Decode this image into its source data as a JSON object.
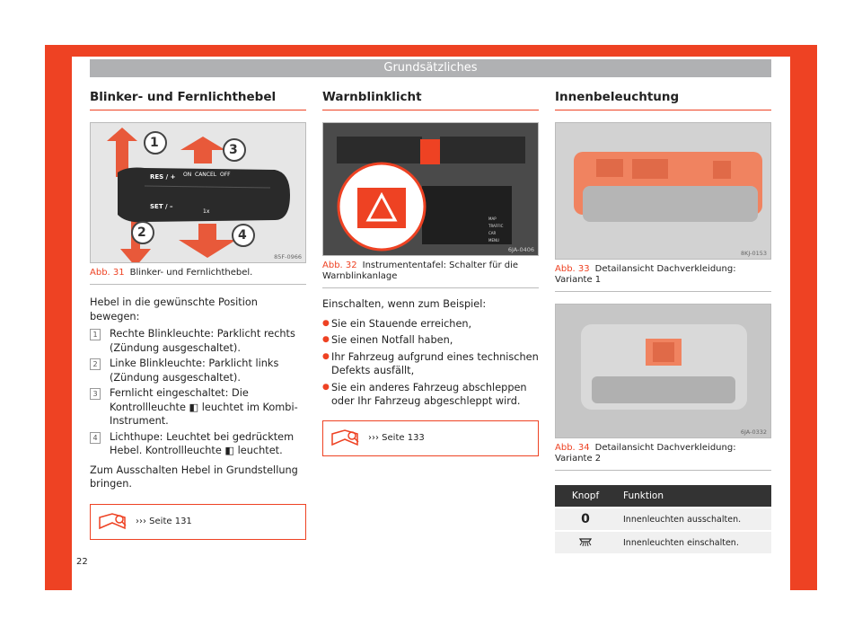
{
  "header": {
    "title": "Grundsätzliches"
  },
  "page_number": "22",
  "col1": {
    "heading": "Blinker- und Fernlichthebel",
    "figure": {
      "code": "85F-0966",
      "label": "Abb. 31",
      "caption": "Blinker- und Fernlichthebel.",
      "callouts": [
        "1",
        "2",
        "3",
        "4"
      ],
      "lever_labels": {
        "res": "RES / +",
        "set": "SET / –",
        "on": "ON",
        "cancel": "CANCEL",
        "off": "OFF",
        "one_x": "1x"
      }
    },
    "intro": "Hebel in die gewünschte Position bewegen:",
    "items": [
      {
        "n": "1",
        "text": "Rechte Blinkleuchte: Parklicht rechts (Zündung ausgeschaltet)."
      },
      {
        "n": "2",
        "text": "Linke Blinkleuchte: Parklicht links (Zündung ausgeschaltet)."
      },
      {
        "n": "3",
        "text": "Fernlicht eingeschaltet: Die Kontrollleuchte ◧ leuchtet im Kombi-Instrument."
      },
      {
        "n": "4",
        "text": "Lichthupe: Leuchtet bei gedrücktem Hebel. Kontrollleuchte ◧ leuchtet."
      }
    ],
    "outro": "Zum Ausschalten Hebel in Grundstellung bringen.",
    "ref": "››› Seite 131"
  },
  "col2": {
    "heading": "Warnblinklicht",
    "figure": {
      "code": "6JA-0406",
      "label": "Abb. 32",
      "caption": "Instrumententafel: Schalter für die Warnblinkanlage",
      "buttons": [
        "MAP",
        "TRAFFIC",
        "CAR",
        "MENU"
      ]
    },
    "intro": "Einschalten, wenn zum Beispiel:",
    "bullets": [
      "Sie ein Stauende erreichen,",
      "Sie einen Notfall haben,",
      "Ihr Fahrzeug aufgrund eines technischen Defekts ausfällt,",
      "Sie ein anderes Fahrzeug abschleppen oder Ihr Fahrzeug abgeschleppt wird."
    ],
    "ref": "››› Seite 133"
  },
  "col3": {
    "heading": "Innenbeleuchtung",
    "figure1": {
      "code": "8KJ-0153",
      "label": "Abb. 33",
      "caption": "Detailansicht Dachverkleidung: Variante 1"
    },
    "figure2": {
      "code": "6JA-0332",
      "label": "Abb. 34",
      "caption": "Detailansicht Dachverkleidung: Variante 2"
    },
    "table": {
      "headers": [
        "Knopf",
        "Funktion"
      ],
      "rows": [
        {
          "knopf": "0",
          "funktion": "Innenleuchten ausschalten."
        },
        {
          "knopf": "lamp-icon",
          "funktion": "Innenleuchten einschalten."
        }
      ]
    }
  },
  "colors": {
    "accent": "#ee4223",
    "header_bar": "#b0b1b3"
  }
}
